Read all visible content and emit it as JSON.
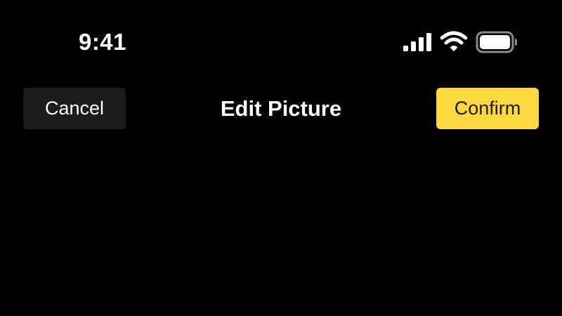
{
  "status_bar": {
    "time": "9:41",
    "icons": {
      "signal": "cellular-signal-icon",
      "wifi": "wifi-icon",
      "battery": "battery-icon"
    }
  },
  "nav": {
    "cancel_label": "Cancel",
    "title": "Edit Picture",
    "confirm_label": "Confirm"
  },
  "colors": {
    "background": "#000000",
    "cancel_button_bg": "#1c1c1e",
    "confirm_button_bg": "#fdd83e",
    "text": "#ffffff",
    "confirm_text": "#1a1a1a"
  }
}
